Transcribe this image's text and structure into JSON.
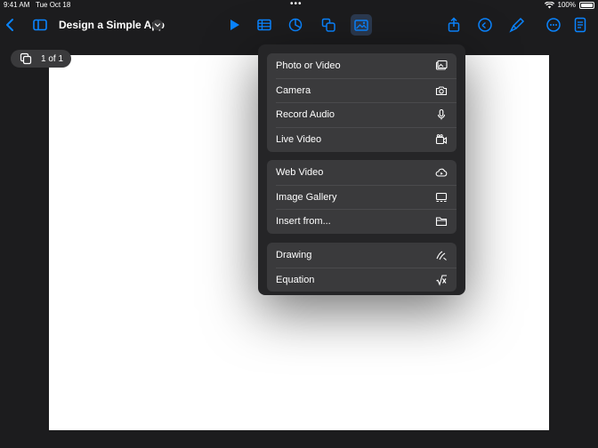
{
  "status_bar": {
    "time": "9:41 AM",
    "date": "Tue Oct 18",
    "dots": "•••",
    "battery": "100%"
  },
  "toolbar": {
    "title": "Design a Simple App",
    "icons": [
      "back-chevron-icon",
      "sidebar-icon",
      "title-chevron-icon",
      "play-icon",
      "table-icon",
      "chart-icon",
      "shapes-icon",
      "media-icon",
      "share-icon",
      "undo-icon",
      "format-brush-icon",
      "more-icon",
      "document-icon"
    ],
    "accent_color": "#0a84ff"
  },
  "slide_counter": {
    "label": "1 of 1"
  },
  "insert_menu": {
    "groups": [
      {
        "items": [
          {
            "label": "Photo or Video",
            "icon": "photo-icon"
          },
          {
            "label": "Camera",
            "icon": "camera-icon"
          },
          {
            "label": "Record Audio",
            "icon": "microphone-icon"
          },
          {
            "label": "Live Video",
            "icon": "live-video-icon"
          }
        ]
      },
      {
        "items": [
          {
            "label": "Web Video",
            "icon": "web-video-icon"
          },
          {
            "label": "Image Gallery",
            "icon": "image-gallery-icon"
          },
          {
            "label": "Insert from...",
            "icon": "folder-icon"
          }
        ]
      },
      {
        "items": [
          {
            "label": "Drawing",
            "icon": "drawing-icon"
          },
          {
            "label": "Equation",
            "icon": "equation-icon"
          }
        ]
      }
    ]
  }
}
